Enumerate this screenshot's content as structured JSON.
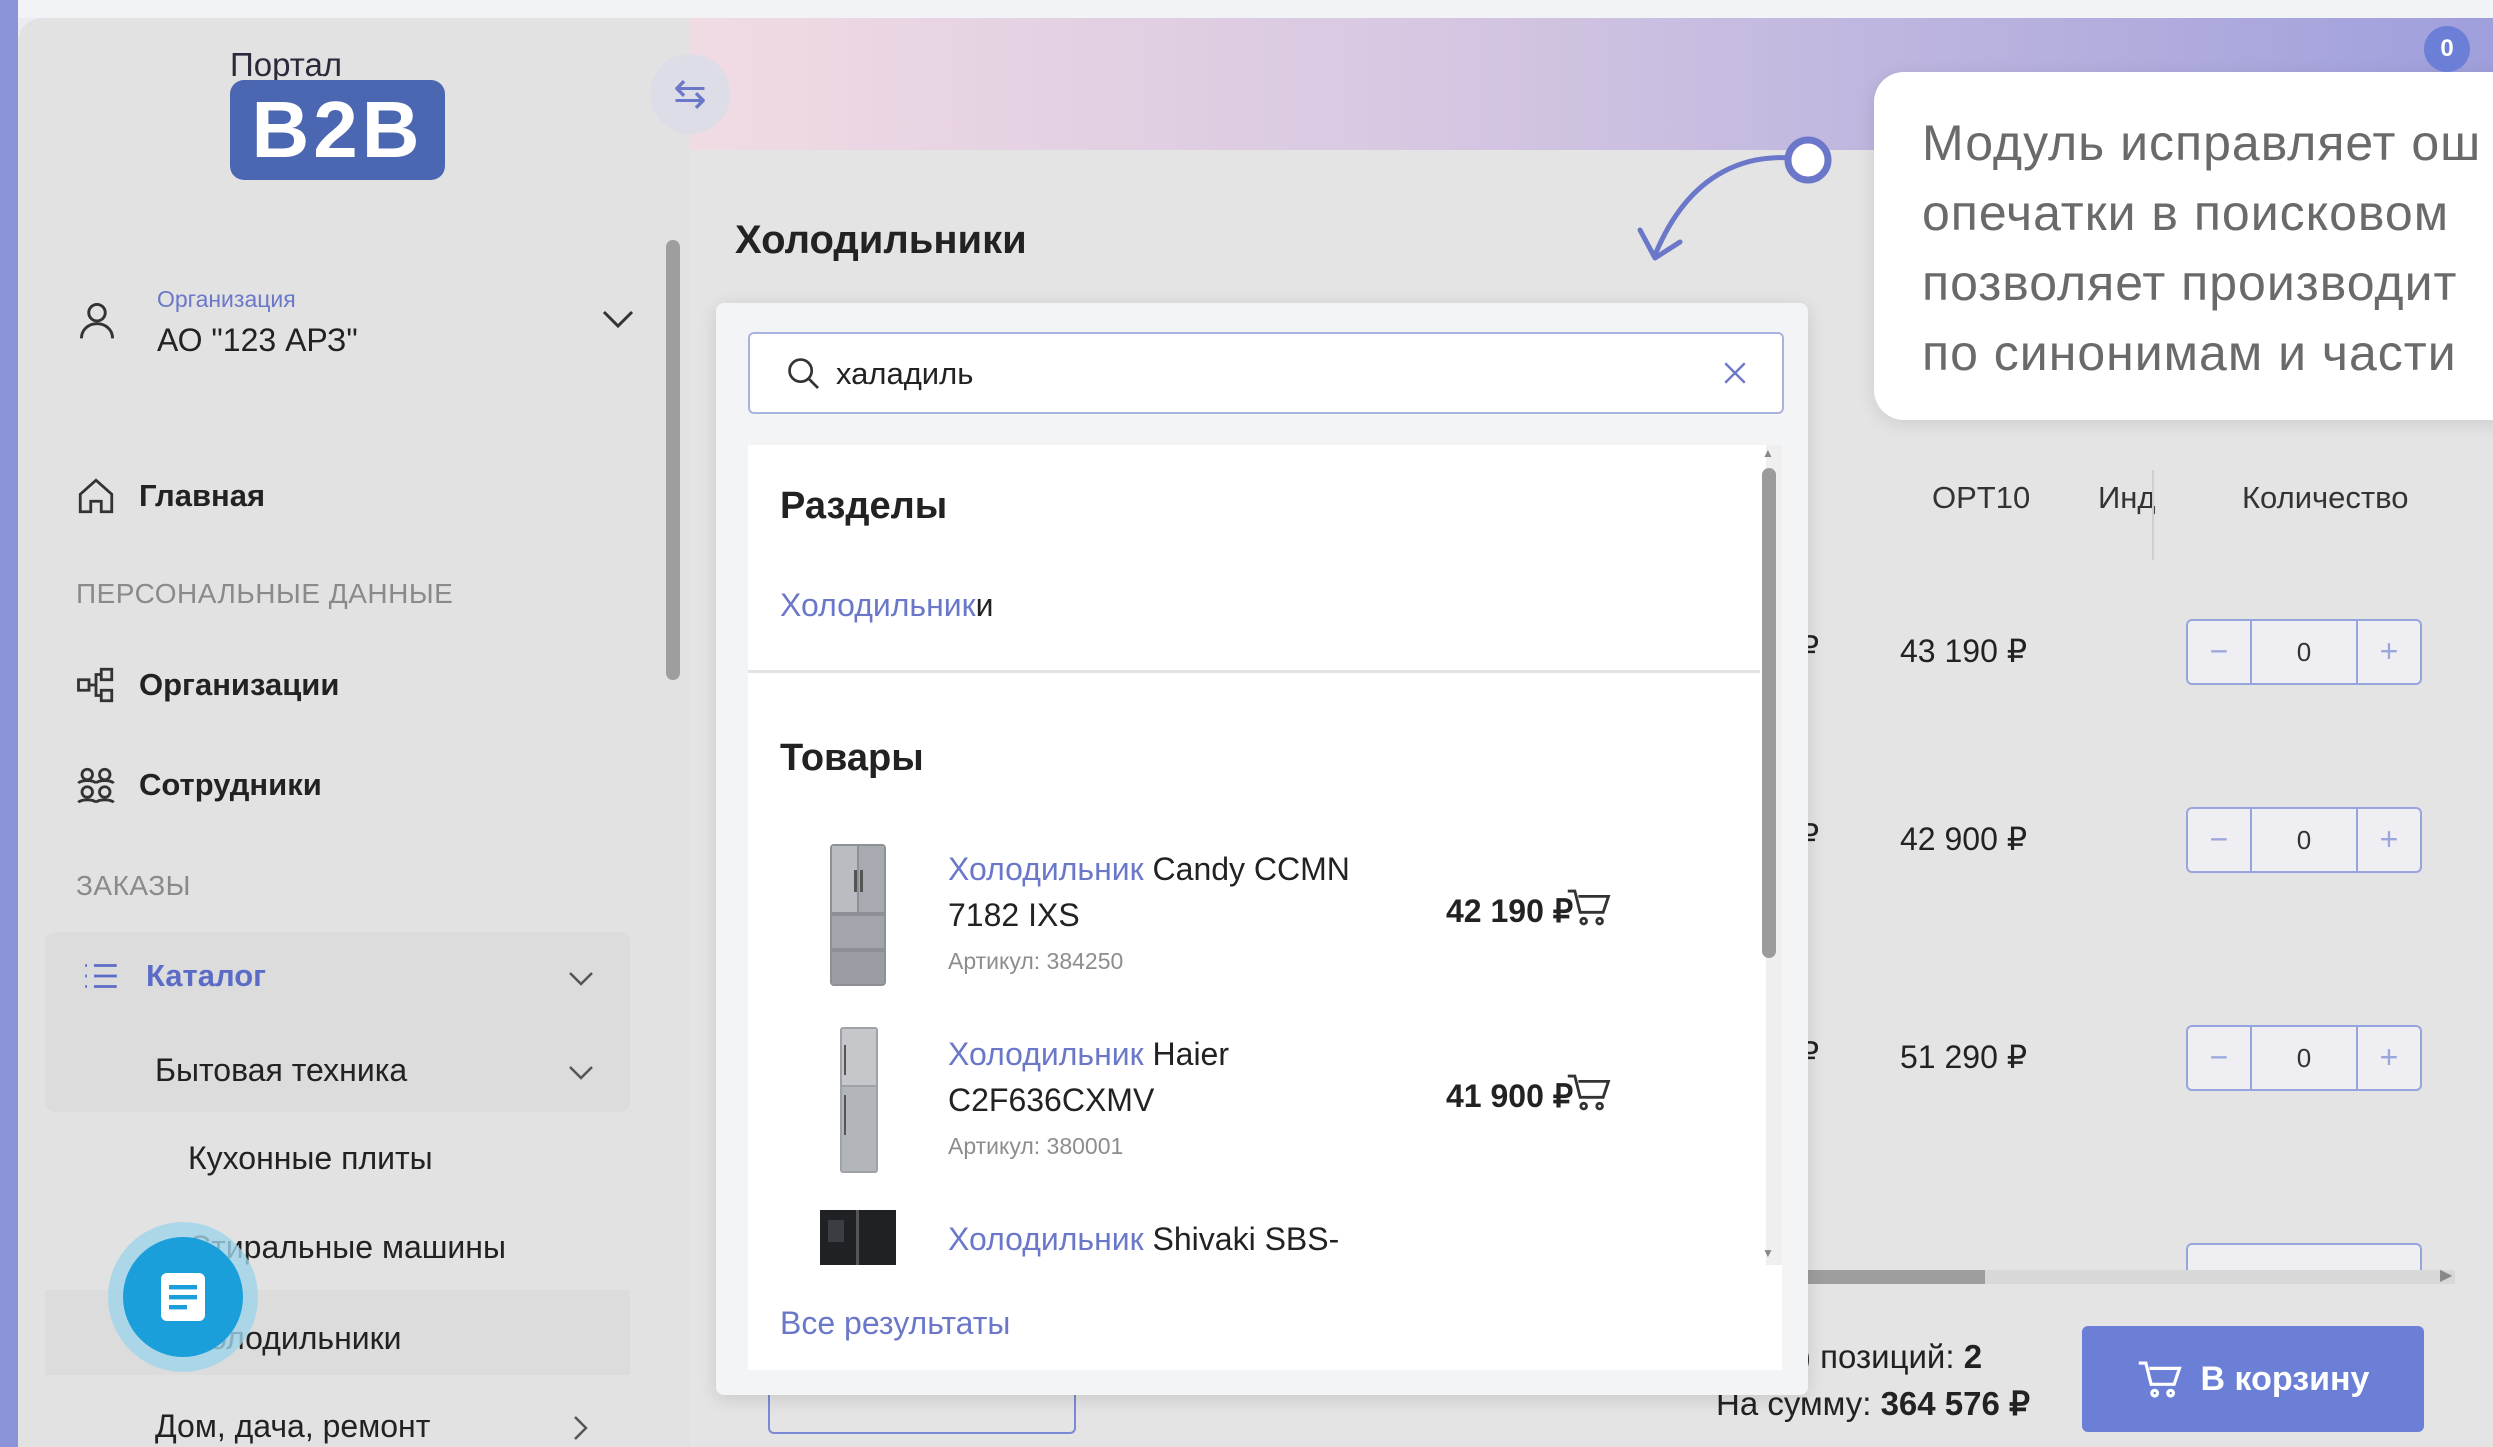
{
  "brand": {
    "top_text": "Портал",
    "logo_text": "B2B"
  },
  "organization": {
    "label": "Организация",
    "name": "АО \"123 АРЗ\""
  },
  "sidebar": {
    "home": "Главная",
    "section_personal": "ПЕРСОНАЛЬНЫЕ ДАННЫЕ",
    "organizations": "Организации",
    "employees": "Сотрудники",
    "section_orders": "ЗАКАЗЫ",
    "catalog": "Каталог",
    "appliances": "Бытовая техника",
    "stoves": "Кухонные плиты",
    "washers": "Стиральные машины",
    "fridges": "Холодильники",
    "home_garden": "Дом, дача, ремонт"
  },
  "page": {
    "title": "Холодильники"
  },
  "search": {
    "value": "халадиль",
    "sections_heading": "Разделы",
    "section_link_highlight": "Холодильник",
    "section_link_rest": "и",
    "products_heading": "Товары",
    "all_results": "Все результаты",
    "products": [
      {
        "highlight": "Холодильник",
        "rest": " Candy CCMN 7182 IXS",
        "sku": "Артикул: 384250",
        "price": "42 190 ₽"
      },
      {
        "highlight": "Холодильник",
        "rest": " Haier C2F636CXMV",
        "sku": "Артикул: 380001",
        "price": "41 900 ₽"
      },
      {
        "highlight": "Холодильник",
        "rest": " Shivaki SBS-",
        "sku": "",
        "price": ""
      }
    ]
  },
  "table": {
    "headers": {
      "c1": ")",
      "c2": "OPT10",
      "c3": "Инд",
      "c4": "Количество"
    },
    "rows": [
      {
        "peek": "₽",
        "price": "43 190 ₽",
        "qty": "0"
      },
      {
        "peek": "₽",
        "price": "42 900 ₽",
        "qty": "0"
      },
      {
        "peek": "₽",
        "price": "51 290 ₽",
        "qty": "0"
      }
    ]
  },
  "summary": {
    "count_label": ") позиций: ",
    "count_value": "2",
    "sum_label": "На сумму: ",
    "sum_value": "364 576 ₽"
  },
  "cart_button": "В корзину",
  "notification_count": "0",
  "callout": {
    "line1": "Модуль исправляет ош",
    "line2": "опечатки в поисковом",
    "line3": "позволяет производит",
    "line4": "по синонимам и части"
  },
  "colors": {
    "accent": "#6b78c9",
    "button": "#6b7fd6",
    "fab": "#1a9fda"
  },
  "icons": [
    "user-icon",
    "chevron-down-icon",
    "home-icon",
    "organizations-icon",
    "employees-icon",
    "list-icon",
    "search-icon",
    "close-icon",
    "cart-icon",
    "swap-icon",
    "document-icon"
  ]
}
